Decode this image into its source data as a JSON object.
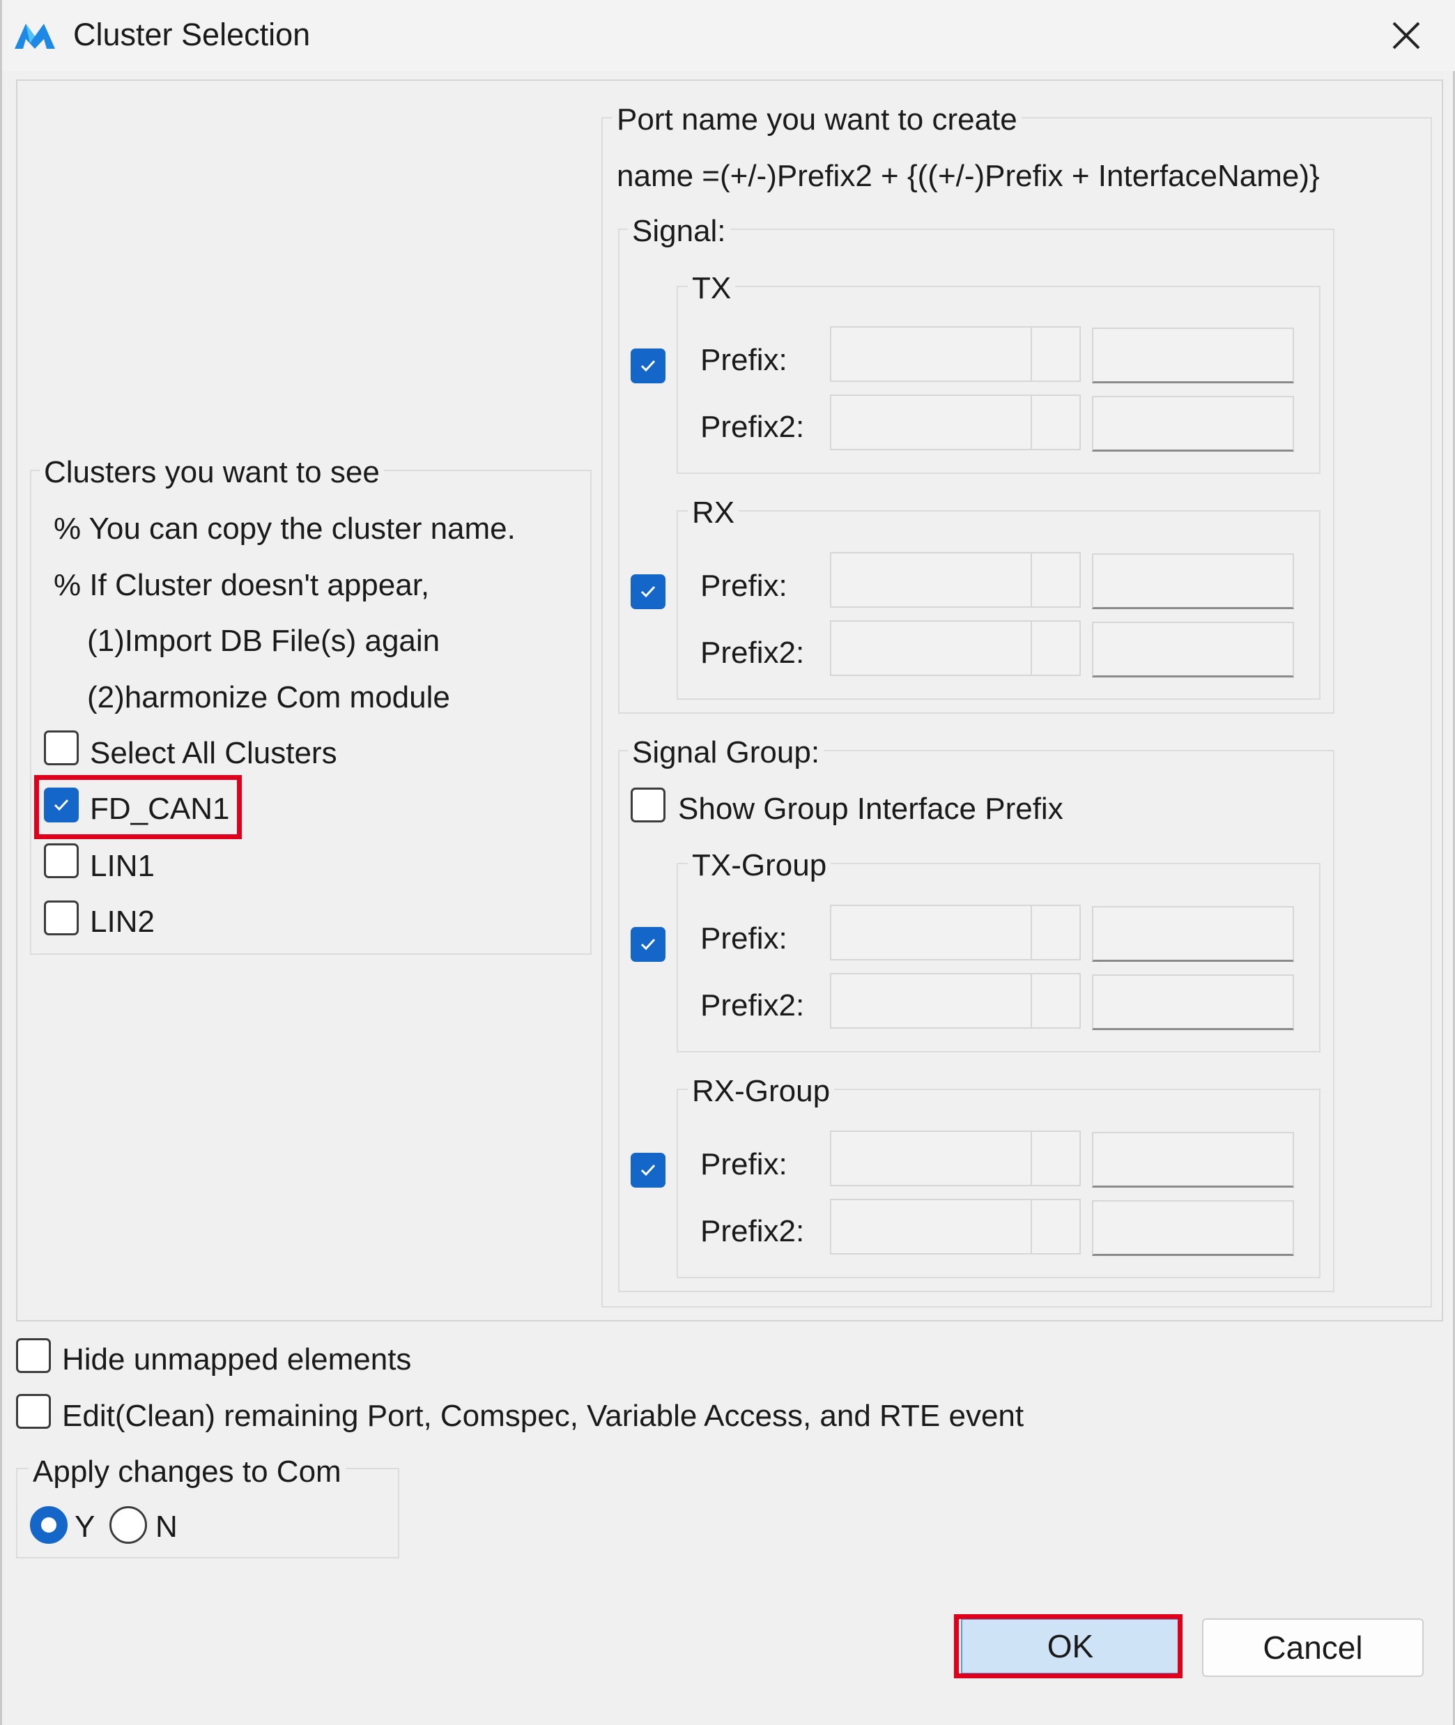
{
  "window": {
    "title": "Cluster Selection",
    "accent_color": "#1466c8",
    "highlight_color": "#e0001b"
  },
  "clusters": {
    "legend": "Clusters you want to see",
    "note1": "% You can copy the cluster name.",
    "note2": "% If Cluster doesn't appear,",
    "note3": "(1)Import DB File(s) again",
    "note4": "(2)harmonize Com module",
    "select_all_label": "Select All Clusters",
    "select_all_checked": false,
    "items": [
      {
        "label": "FD_CAN1",
        "checked": true
      },
      {
        "label": "LIN1",
        "checked": false
      },
      {
        "label": "LIN2",
        "checked": false
      }
    ]
  },
  "port_name": {
    "legend": "Port name you want to create",
    "formula": "name =(+/-)Prefix2 + {((+/-)Prefix + InterfaceName)}",
    "signal": {
      "legend": "Signal:",
      "tx": {
        "legend": "TX",
        "checked": true,
        "prefix_label": "Prefix:",
        "prefix2_label": "Prefix2:"
      },
      "rx": {
        "legend": "RX",
        "checked": true,
        "prefix_label": "Prefix:",
        "prefix2_label": "Prefix2:"
      }
    },
    "signal_group": {
      "legend": "Signal Group:",
      "show_prefix_label": "Show Group Interface Prefix",
      "show_prefix_checked": false,
      "tx_group": {
        "legend": "TX-Group",
        "checked": true,
        "prefix_label": "Prefix:",
        "prefix2_label": "Prefix2:"
      },
      "rx_group": {
        "legend": "RX-Group",
        "checked": true,
        "prefix_label": "Prefix:",
        "prefix2_label": "Prefix2:"
      }
    }
  },
  "options": {
    "hide_unmapped_label": "Hide unmapped elements",
    "hide_unmapped_checked": false,
    "edit_clean_label": "Edit(Clean) remaining Port, Comspec, Variable Access, and RTE event",
    "edit_clean_checked": false
  },
  "apply_com": {
    "legend": "Apply changes to Com",
    "yes_label": "Y",
    "no_label": "N",
    "selected": "Y"
  },
  "buttons": {
    "ok_label": "OK",
    "cancel_label": "Cancel"
  }
}
